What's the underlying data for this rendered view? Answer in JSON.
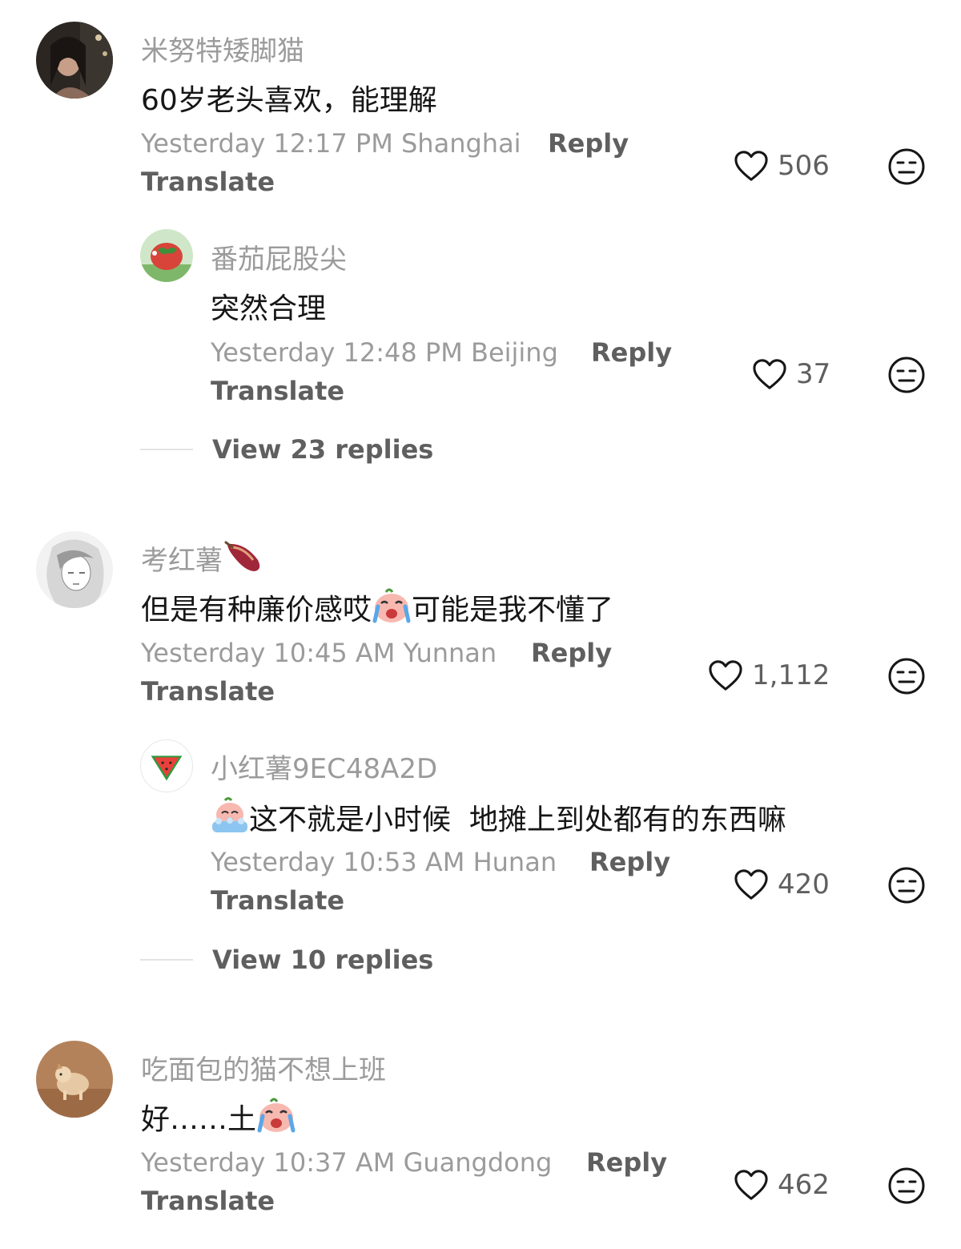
{
  "comments": [
    {
      "username": "米努特矮脚猫",
      "text": "60岁老头喜欢，能理解",
      "time_location": "Yesterday 12:17 PM Shanghai",
      "reply_label": "Reply",
      "translate_label": "Translate",
      "likes": "506",
      "replies": [
        {
          "username": "番茄屁股尖",
          "text": "突然合理",
          "time_location": "Yesterday 12:48 PM Beijing",
          "reply_label": "Reply",
          "translate_label": "Translate",
          "likes": "37"
        }
      ],
      "view_replies_label": "View 23 replies"
    },
    {
      "username": "考红薯",
      "username_emoji": "sweet-potato-icon",
      "text_before_emoji": "但是有种廉价感哎",
      "text_emoji": "crying-face-icon",
      "text_after_emoji": "可能是我不懂了",
      "time_location": "Yesterday 10:45 AM Yunnan",
      "reply_label": "Reply",
      "translate_label": "Translate",
      "likes": "1,112",
      "replies": [
        {
          "username": "小红薯9EC48A2D",
          "text_emoji": "crying-bath-icon",
          "text": "这不就是小时候  地摊上到处都有的东西嘛",
          "time_location": "Yesterday 10:53 AM Hunan",
          "reply_label": "Reply",
          "translate_label": "Translate",
          "likes": "420"
        }
      ],
      "view_replies_label": "View 10 replies"
    },
    {
      "username": "吃面包的猫不想上班",
      "text": "好……土",
      "text_emoji": "crying-face-icon",
      "time_location": "Yesterday 10:37 AM Guangdong",
      "reply_label": "Reply",
      "translate_label": "Translate",
      "likes": "462"
    }
  ],
  "colors": {
    "username": "#9b9b9b",
    "body_text": "#161616",
    "action_text": "#5f5f5f",
    "divider": "#e3e3e3"
  }
}
